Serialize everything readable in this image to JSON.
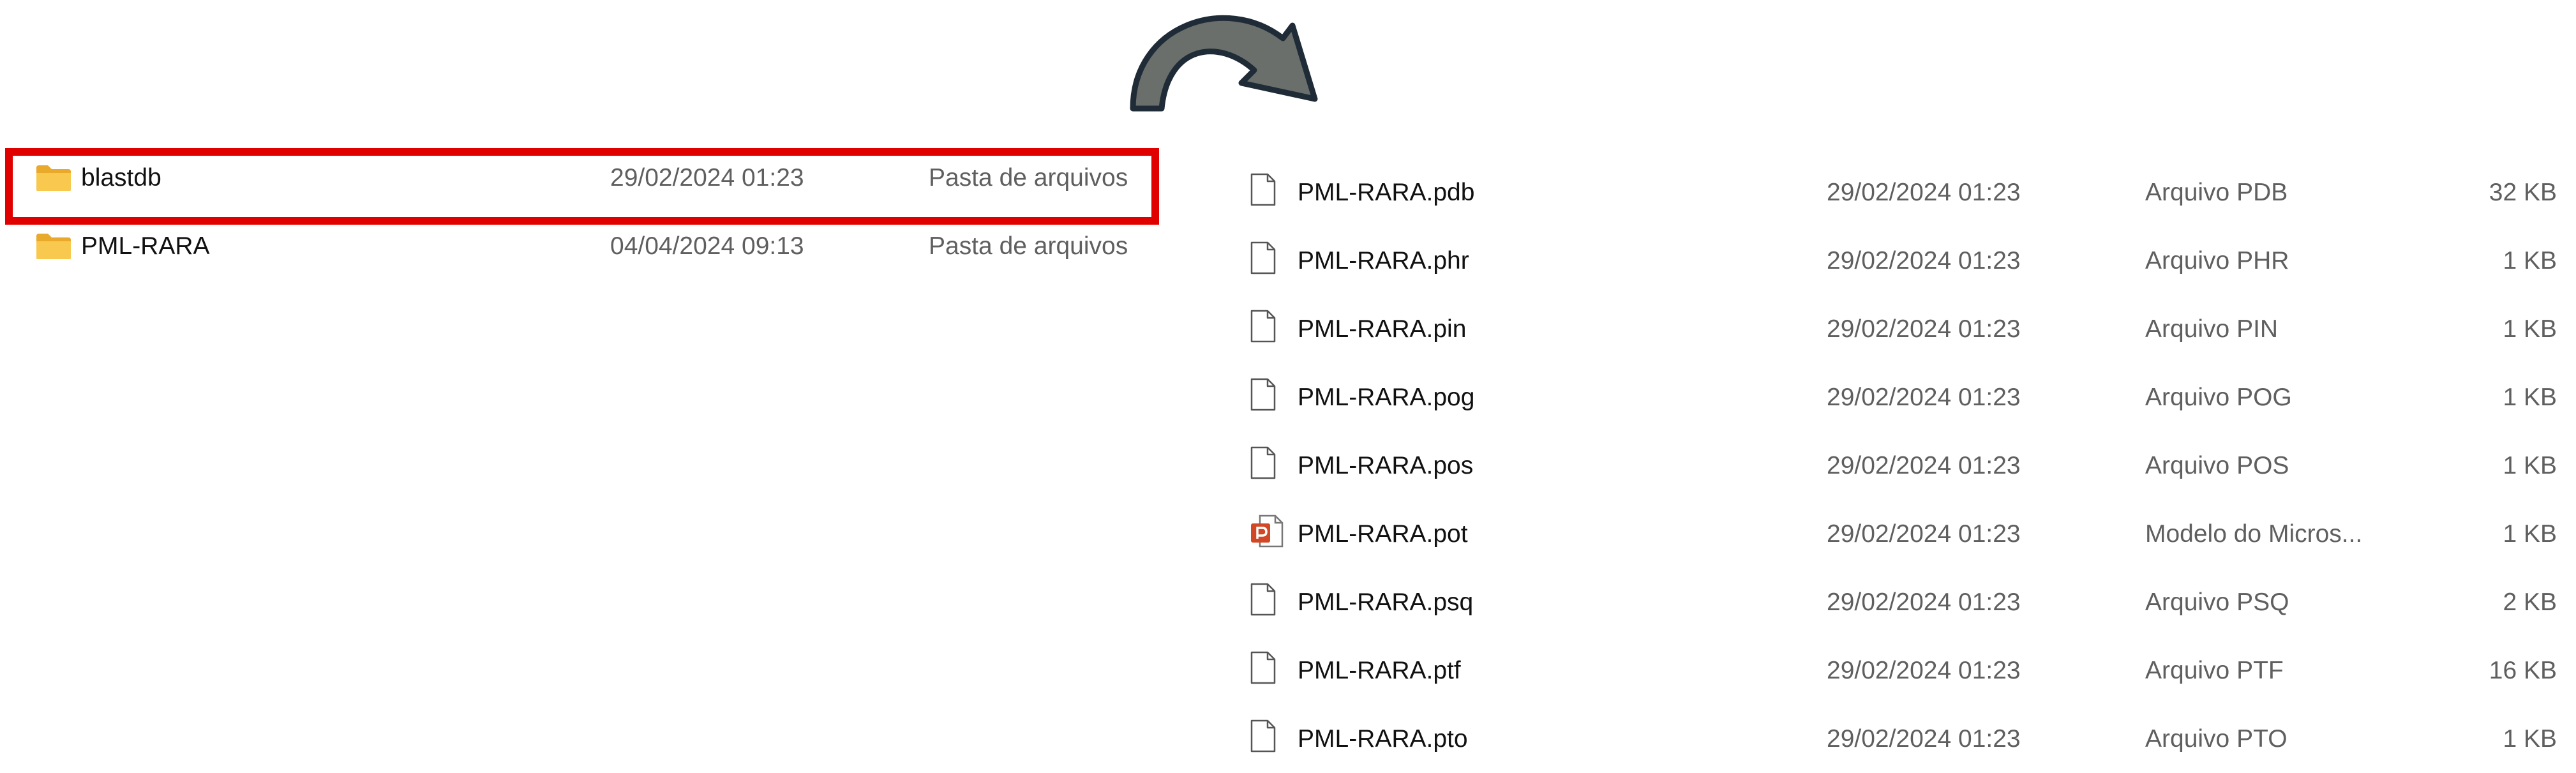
{
  "colors": {
    "selection_border": "#e10000",
    "folder": "#f5c242",
    "arrow_fill": "#6a6f6c",
    "arrow_stroke": "#1f2b36",
    "ppt_accent": "#d24726"
  },
  "left_list": {
    "rows": [
      {
        "name": "blastdb",
        "date": "29/02/2024 01:23",
        "type": "Pasta de arquivos",
        "icon": "folder-icon",
        "highlighted": true
      },
      {
        "name": "PML-RARA",
        "date": "04/04/2024 09:13",
        "type": "Pasta de arquivos",
        "icon": "folder-icon",
        "highlighted": false
      }
    ]
  },
  "right_list": {
    "rows": [
      {
        "name": "PML-RARA.pdb",
        "date": "29/02/2024 01:23",
        "type": "Arquivo PDB",
        "size": "32 KB",
        "icon": "file-icon"
      },
      {
        "name": "PML-RARA.phr",
        "date": "29/02/2024 01:23",
        "type": "Arquivo PHR",
        "size": "1 KB",
        "icon": "file-icon"
      },
      {
        "name": "PML-RARA.pin",
        "date": "29/02/2024 01:23",
        "type": "Arquivo PIN",
        "size": "1 KB",
        "icon": "file-icon"
      },
      {
        "name": "PML-RARA.pog",
        "date": "29/02/2024 01:23",
        "type": "Arquivo POG",
        "size": "1 KB",
        "icon": "file-icon"
      },
      {
        "name": "PML-RARA.pos",
        "date": "29/02/2024 01:23",
        "type": "Arquivo POS",
        "size": "1 KB",
        "icon": "file-icon"
      },
      {
        "name": "PML-RARA.pot",
        "date": "29/02/2024 01:23",
        "type": "Modelo do Micros...",
        "size": "1 KB",
        "icon": "powerpoint-template-icon"
      },
      {
        "name": "PML-RARA.psq",
        "date": "29/02/2024 01:23",
        "type": "Arquivo PSQ",
        "size": "2 KB",
        "icon": "file-icon"
      },
      {
        "name": "PML-RARA.ptf",
        "date": "29/02/2024 01:23",
        "type": "Arquivo PTF",
        "size": "16 KB",
        "icon": "file-icon"
      },
      {
        "name": "PML-RARA.pto",
        "date": "29/02/2024 01:23",
        "type": "Arquivo PTO",
        "size": "1 KB",
        "icon": "file-icon"
      }
    ]
  }
}
